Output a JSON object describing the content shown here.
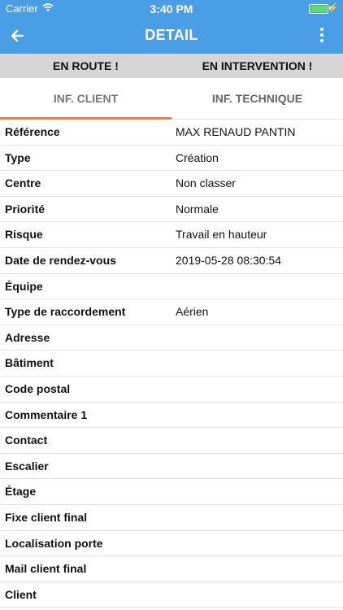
{
  "status_bar": {
    "carrier": "Carrier",
    "time": "3:40 PM",
    "icons": [
      "wifi-icon",
      "battery-icon",
      "charging-icon"
    ]
  },
  "nav": {
    "title": "DETAIL",
    "back_icon": "arrow-left-icon",
    "menu_icon": "more-vertical-icon",
    "color": "#4a9ee6"
  },
  "actions": {
    "en_route": "EN ROUTE !",
    "en_intervention": "EN INTERVENTION !"
  },
  "tabs": [
    {
      "label": "INF. CLIENT",
      "active": true
    },
    {
      "label": "INF. TECHNIQUE",
      "active": false
    }
  ],
  "accent_color": "#f07b43",
  "rows": [
    {
      "label": "Référence",
      "value": "MAX RENAUD PANTIN"
    },
    {
      "label": "Type",
      "value": "Création"
    },
    {
      "label": "Centre",
      "value": "Non classer"
    },
    {
      "label": "Priorité",
      "value": "Normale"
    },
    {
      "label": "Risque",
      "value": "Travail en hauteur"
    },
    {
      "label": "Date de rendez-vous",
      "value": "2019-05-28 08:30:54"
    },
    {
      "label": "Équipe",
      "value": ""
    },
    {
      "label": "Type de raccordement",
      "value": "Aérien"
    },
    {
      "label": "Adresse",
      "value": ""
    },
    {
      "label": "Bâtiment",
      "value": ""
    },
    {
      "label": "Code postal",
      "value": ""
    },
    {
      "label": "Commentaire 1",
      "value": ""
    },
    {
      "label": "Contact",
      "value": ""
    },
    {
      "label": "Escalier",
      "value": ""
    },
    {
      "label": "Étage",
      "value": ""
    },
    {
      "label": "Fixe client final",
      "value": ""
    },
    {
      "label": "Localisation porte",
      "value": ""
    },
    {
      "label": "Mail client final",
      "value": ""
    },
    {
      "label": "Client",
      "value": ""
    }
  ]
}
